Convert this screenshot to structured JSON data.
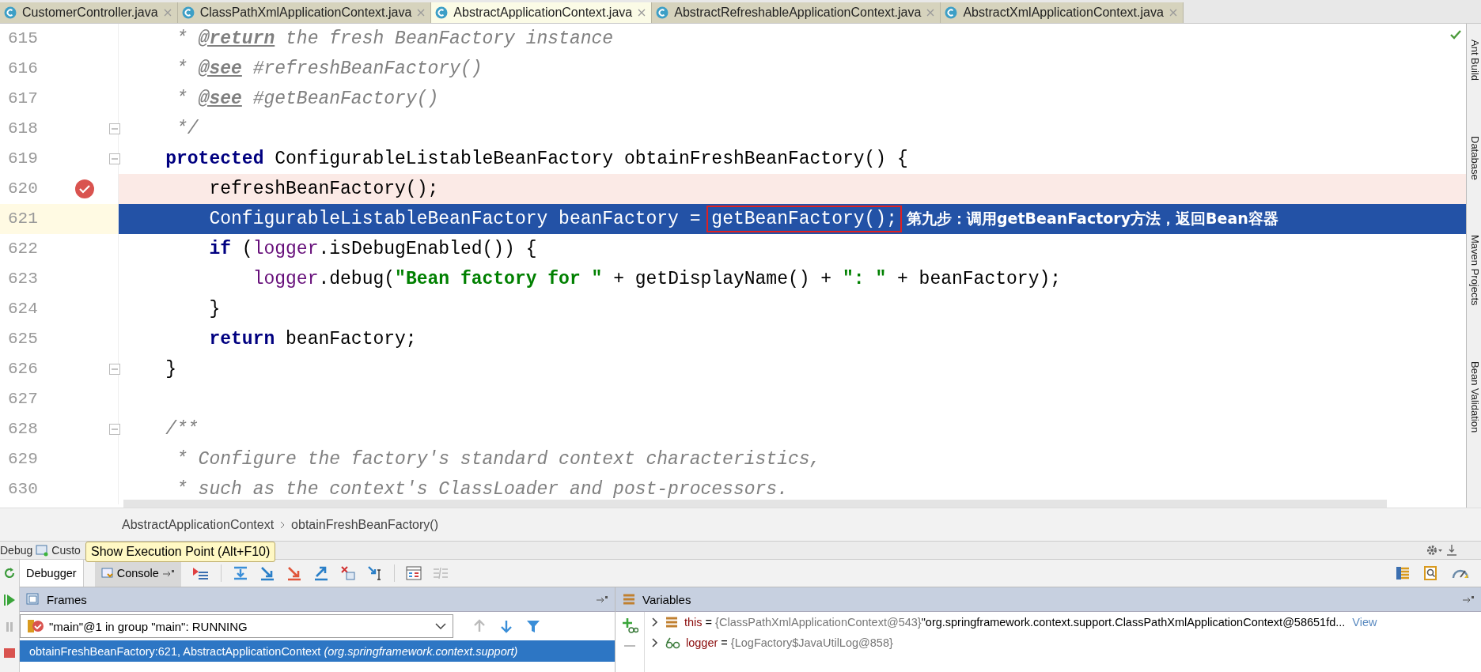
{
  "tabs": [
    {
      "label": "CustomerController.java",
      "selected": false
    },
    {
      "label": "ClassPathXmlApplicationContext.java",
      "selected": false
    },
    {
      "label": "AbstractApplicationContext.java",
      "selected": true
    },
    {
      "label": "AbstractRefreshableApplicationContext.java",
      "selected": false
    },
    {
      "label": "AbstractXmlApplicationContext.java",
      "selected": false
    }
  ],
  "editor": {
    "lines": [
      {
        "number": "615",
        "breakpoint": false,
        "current": false,
        "fold": false,
        "segments": [
          {
            "kind": "comment",
            "text": "     * "
          },
          {
            "kind": "tag",
            "text": "@return"
          },
          {
            "kind": "comment",
            "text": " the fresh BeanFactory instance"
          }
        ]
      },
      {
        "number": "616",
        "breakpoint": false,
        "current": false,
        "fold": false,
        "segments": [
          {
            "kind": "comment",
            "text": "     * "
          },
          {
            "kind": "tag",
            "text": "@see"
          },
          {
            "kind": "comment",
            "text": " #refreshBeanFactory()"
          }
        ]
      },
      {
        "number": "617",
        "breakpoint": false,
        "current": false,
        "fold": false,
        "segments": [
          {
            "kind": "comment",
            "text": "     * "
          },
          {
            "kind": "tag",
            "text": "@see"
          },
          {
            "kind": "comment",
            "text": " #getBeanFactory()"
          }
        ]
      },
      {
        "number": "618",
        "breakpoint": false,
        "current": false,
        "fold": true,
        "segments": [
          {
            "kind": "comment",
            "text": "     */"
          }
        ]
      },
      {
        "number": "619",
        "breakpoint": false,
        "current": false,
        "fold": true,
        "segments": [
          {
            "kind": "keyword",
            "text": "    protected"
          },
          {
            "kind": "plain",
            "text": " ConfigurableListableBeanFactory obtainFreshBeanFactory() {"
          }
        ]
      },
      {
        "number": "620",
        "breakpoint": true,
        "current": false,
        "fold": false,
        "segments": [
          {
            "kind": "plain",
            "text": "        refreshBeanFactory();"
          }
        ]
      },
      {
        "number": "621",
        "breakpoint": false,
        "current": true,
        "fold": false,
        "annotation": "第九步：调用getBeanFactory方法，返回Bean容器",
        "segments": [
          {
            "kind": "plain",
            "text": "        ConfigurableListableBeanFactory beanFactory = "
          },
          {
            "kind": "boxed",
            "text": "getBeanFactory();"
          }
        ]
      },
      {
        "number": "622",
        "breakpoint": false,
        "current": false,
        "fold": false,
        "segments": [
          {
            "kind": "keyword",
            "text": "        if"
          },
          {
            "kind": "plain",
            "text": " ("
          },
          {
            "kind": "field",
            "text": "logger"
          },
          {
            "kind": "plain",
            "text": ".isDebugEnabled()) {"
          }
        ]
      },
      {
        "number": "623",
        "breakpoint": false,
        "current": false,
        "fold": false,
        "segments": [
          {
            "kind": "field",
            "text": "            logger"
          },
          {
            "kind": "plain",
            "text": ".debug("
          },
          {
            "kind": "string",
            "text": "\"Bean factory for \""
          },
          {
            "kind": "plain",
            "text": " + getDisplayName() + "
          },
          {
            "kind": "string",
            "text": "\": \""
          },
          {
            "kind": "plain",
            "text": " + beanFactory);"
          }
        ]
      },
      {
        "number": "624",
        "breakpoint": false,
        "current": false,
        "fold": false,
        "segments": [
          {
            "kind": "plain",
            "text": "        }"
          }
        ]
      },
      {
        "number": "625",
        "breakpoint": false,
        "current": false,
        "fold": false,
        "segments": [
          {
            "kind": "keyword",
            "text": "        return"
          },
          {
            "kind": "plain",
            "text": " beanFactory;"
          }
        ]
      },
      {
        "number": "626",
        "breakpoint": false,
        "current": false,
        "fold": true,
        "segments": [
          {
            "kind": "plain",
            "text": "    }"
          }
        ]
      },
      {
        "number": "627",
        "breakpoint": false,
        "current": false,
        "fold": false
      },
      {
        "number": "628",
        "breakpoint": false,
        "current": false,
        "fold": true,
        "segments": [
          {
            "kind": "comment",
            "text": "    /**"
          }
        ]
      },
      {
        "number": "629",
        "breakpoint": false,
        "current": false,
        "fold": false,
        "segments": [
          {
            "kind": "comment",
            "text": "     * Configure the factory's standard context characteristics,"
          }
        ]
      },
      {
        "number": "630",
        "breakpoint": false,
        "current": false,
        "fold": false,
        "segments": [
          {
            "kind": "comment",
            "text": "     * such as the context's ClassLoader and post-processors."
          }
        ]
      }
    ]
  },
  "side_tools": [
    "Ant Build",
    "Database",
    "Maven Projects",
    "Bean Validation"
  ],
  "breadcrumb": [
    "AbstractApplicationContext",
    "obtainFreshBeanFactory()"
  ],
  "debug": {
    "title": "Debug",
    "run_config": "Custo",
    "tooltip": "Show Execution Point (Alt+F10)",
    "tabs": [
      {
        "label": "Debugger",
        "selected": true
      },
      {
        "label": "Console",
        "selected": false
      }
    ],
    "frames": {
      "title": "Frames",
      "thread": "\"main\"@1 in group \"main\": RUNNING",
      "items": [
        {
          "text": "obtainFreshBeanFactory:621, AbstractApplicationContext *(org.springframework.context.support)*",
          "selected": true
        }
      ]
    },
    "variables": {
      "title": "Variables",
      "items": [
        {
          "kind": "field",
          "name": "this",
          "operator": "=",
          "type": "{ClassPathXmlApplicationContext@543}",
          "value": "\"org.springframework.context.support.ClassPathXmlApplicationContext@58651fd...",
          "link": "View"
        },
        {
          "kind": "watch",
          "name": "logger",
          "operator": "=",
          "type": "{LogFactory$JavaUtilLog@858}"
        }
      ]
    }
  }
}
